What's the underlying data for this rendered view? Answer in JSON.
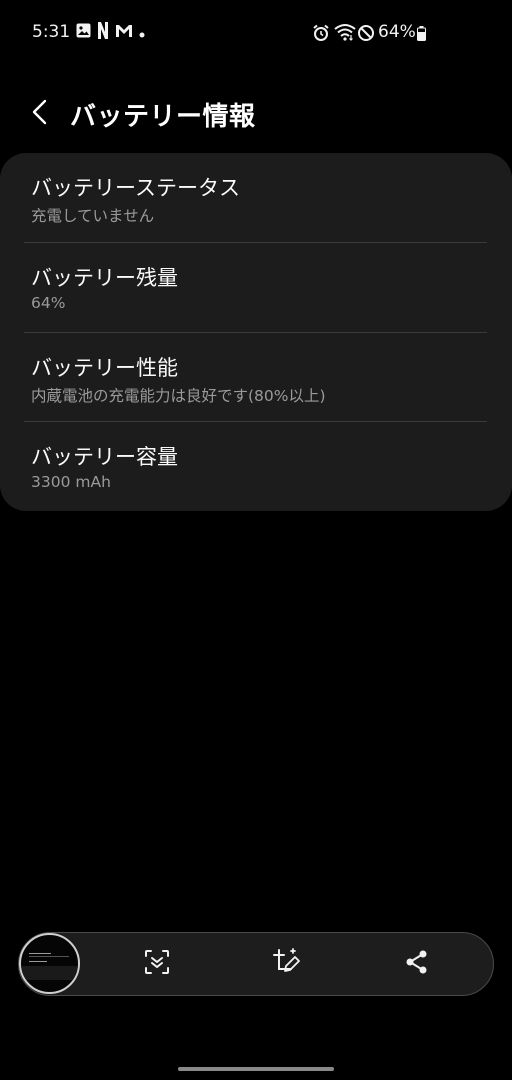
{
  "status_bar": {
    "time": "5:31",
    "battery_percent": "64%",
    "left_icons": [
      "image-icon",
      "netflix-icon",
      "gmail-icon",
      "dot-icon"
    ],
    "right_icons": [
      "alarm-icon",
      "wifi-icon",
      "do-not-disturb-icon",
      "battery-icon"
    ]
  },
  "header": {
    "back_icon": "chevron-left-icon",
    "title": "バッテリー情報"
  },
  "items": [
    {
      "title": "バッテリーステータス",
      "subtitle": "充電していません"
    },
    {
      "title": "バッテリー残量",
      "subtitle": "64%"
    },
    {
      "title": "バッテリー性能",
      "subtitle": "内蔵電池の充電能力は良好です(80%以上)"
    },
    {
      "title": "バッテリー容量",
      "subtitle": "3300 mAh"
    }
  ],
  "toolbar": {
    "icons": [
      "screenshot-thumbnail",
      "scroll-capture-icon",
      "edit-crop-icon",
      "share-icon"
    ]
  },
  "colors": {
    "background": "#000000",
    "card": "#1c1c1c",
    "title_text": "#fafafa",
    "subtitle_text": "#9a9a9a",
    "divider": "#3a3a3a"
  }
}
